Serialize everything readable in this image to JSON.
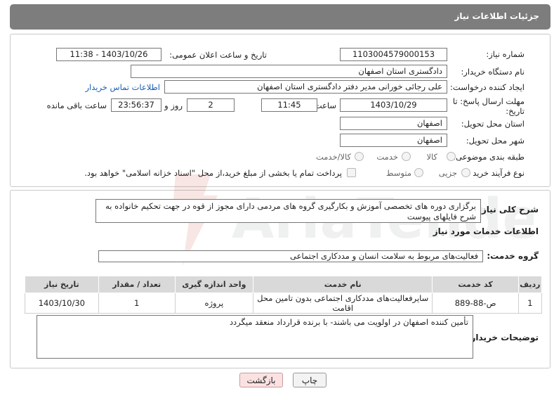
{
  "header": {
    "title": "جزئیات اطلاعات نیاز"
  },
  "form": {
    "need_number": {
      "label": "شماره نیاز:",
      "value": "1103004579000153"
    },
    "announce_datetime": {
      "label": "تاریخ و ساعت اعلان عمومی:",
      "value": "1403/10/26 - 11:38"
    },
    "buyer_org": {
      "label": "نام دستگاه خریدار:",
      "value": "دادگستری استان اصفهان"
    },
    "requester": {
      "label": "ایجاد کننده درخواست:",
      "value": "علی رجائی خورانی مدیر دفتر دادگستری استان اصفهان",
      "contact_link": "اطلاعات تماس خریدار"
    },
    "deadline": {
      "label_line1": "مهلت ارسال پاسخ: تا",
      "label_line2": "تاریخ:",
      "date": "1403/10/29",
      "time_label": "ساعت",
      "time": "11:45",
      "days": "2",
      "days_label": "روز و",
      "remaining": "23:56:37",
      "remaining_label": "ساعت باقی مانده"
    },
    "province": {
      "label": "استان محل تحویل:",
      "value": "اصفهان"
    },
    "city": {
      "label": "شهر محل تحویل:",
      "value": "اصفهان"
    },
    "category": {
      "label": "طبقه بندی موضوعی:",
      "options": [
        "کالا",
        "خدمت",
        "کالا/خدمت"
      ]
    },
    "purchase_type": {
      "label": "نوع فرآیند خرید :",
      "options": [
        "جزیی",
        "متوسط"
      ],
      "note": "پرداخت تمام یا بخشی از مبلغ خرید،از محل \"اسناد خزانه اسلامی\" خواهد بود."
    }
  },
  "summary": {
    "label": "شرح کلی نیاز:",
    "text": "برگزاری دوره های تخصصی آموزش و بکارگیری گروه های مردمی دارای مجوز از قوه در جهت تحکیم خانواده به شرح فایلهای پیوست"
  },
  "services": {
    "section_title": "اطلاعات خدمات مورد نیاز",
    "group_label": "گروه خدمت:",
    "group_value": "فعالیت‌های مربوط به سلامت انسان و مددکاری اجتماعی",
    "columns": [
      "ردیف",
      "کد خدمت",
      "نام خدمت",
      "واحد اندازه گیری",
      "تعداد / مقدار",
      "تاریخ نیاز"
    ],
    "rows": [
      [
        "1",
        "ص-88-889",
        "سایرفعالیت‌های مددکاری اجتماعی بدون تامین محل اقامت",
        "پروژه",
        "1",
        "1403/10/30"
      ]
    ]
  },
  "buyer_notes": {
    "label": "توضیحات خریدار:",
    "text": "تأمین کننده اصفهان در اولویت می باشند- با برنده قرارداد منعقد میگردد"
  },
  "buttons": {
    "print": "چاپ",
    "back": "بازگشت"
  },
  "watermark": {
    "text": "AriaTender.neT"
  }
}
